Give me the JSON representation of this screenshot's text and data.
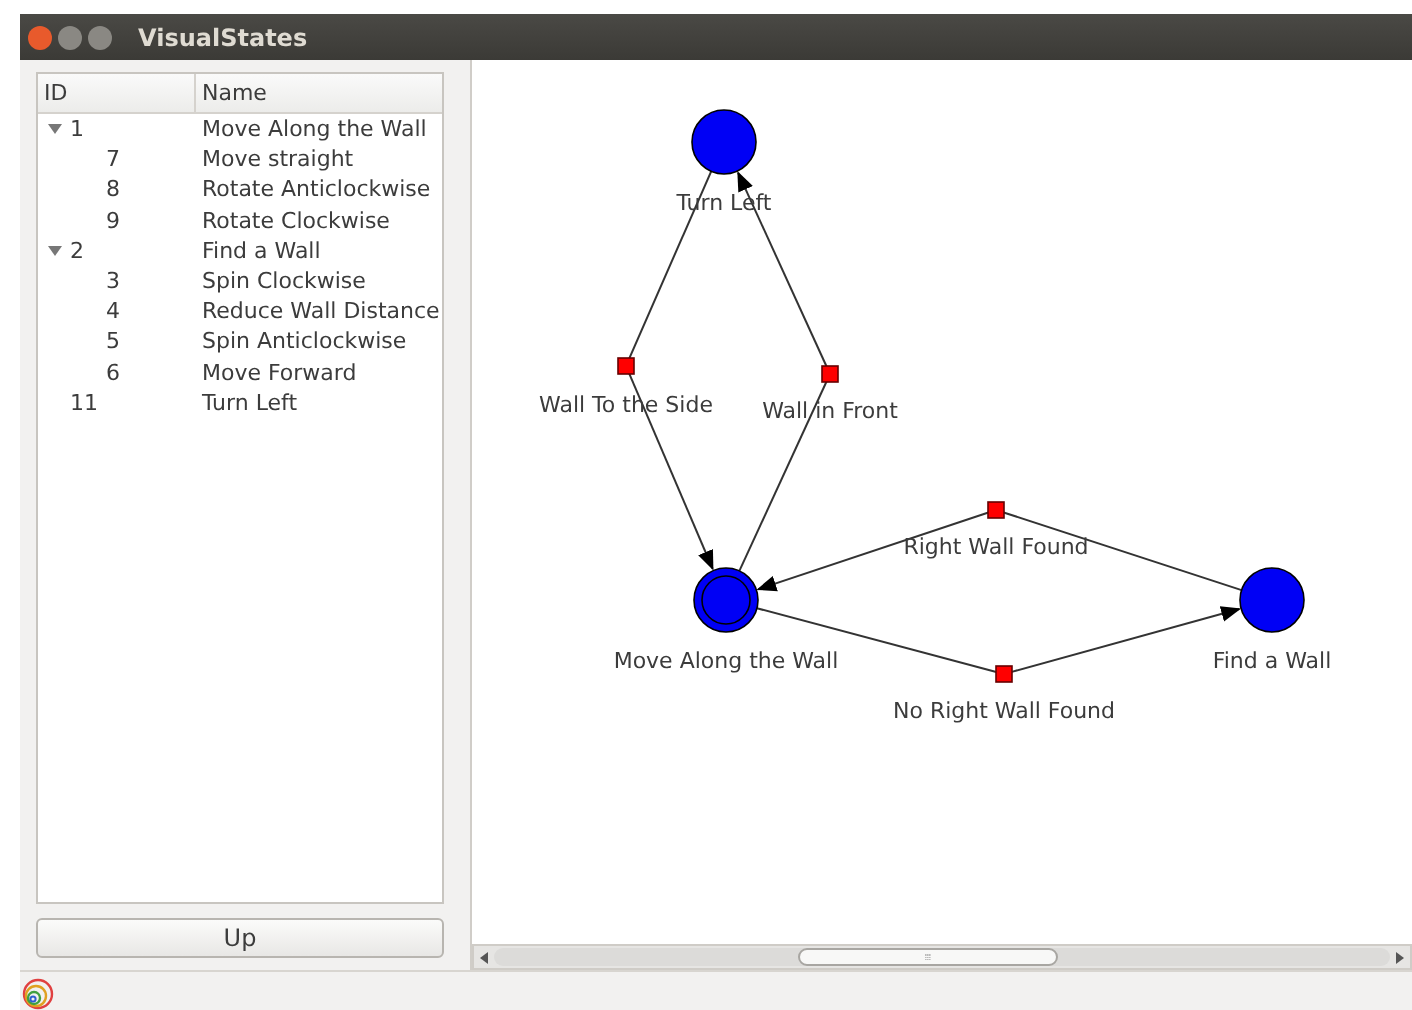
{
  "window": {
    "title": "VisualStates"
  },
  "tree": {
    "columns": [
      "ID",
      "Name"
    ],
    "items": [
      {
        "id": "1",
        "name": "Move Along the Wall",
        "expanded": true,
        "children": [
          {
            "id": "7",
            "name": "Move straight"
          },
          {
            "id": "8",
            "name": "Rotate Anticlockwise"
          },
          {
            "id": "9",
            "name": "Rotate Clockwise"
          }
        ]
      },
      {
        "id": "2",
        "name": "Find a Wall",
        "expanded": true,
        "children": [
          {
            "id": "3",
            "name": "Spin Clockwise"
          },
          {
            "id": "4",
            "name": "Reduce Wall Distance"
          },
          {
            "id": "5",
            "name": "Spin Anticlockwise"
          },
          {
            "id": "6",
            "name": "Move Forward"
          }
        ]
      },
      {
        "id": "11",
        "name": "Turn Left"
      }
    ]
  },
  "up_button": "Up",
  "diagram": {
    "states": [
      {
        "label": "Turn Left",
        "initial": false
      },
      {
        "label": "Move Along the Wall",
        "initial": true
      },
      {
        "label": "Find a Wall",
        "initial": false
      }
    ],
    "transitions": [
      {
        "label": "Wall To the Side"
      },
      {
        "label": "Wall in Front"
      },
      {
        "label": "Right Wall Found"
      },
      {
        "label": "No Right Wall Found"
      }
    ]
  },
  "scrollbar_grip": "⦙⦙⦙"
}
